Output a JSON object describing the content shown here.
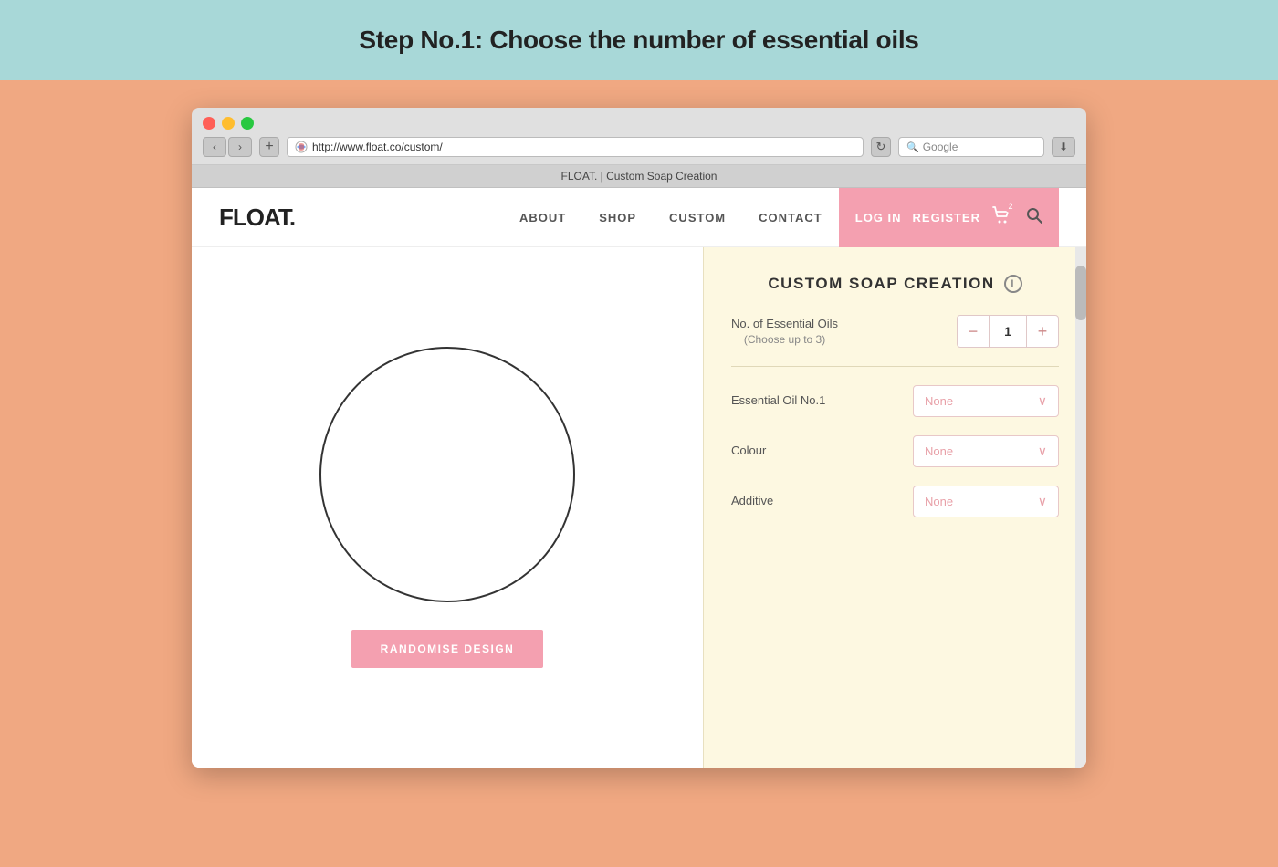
{
  "instruction": {
    "text": "Step No.1: Choose the number of essential oils"
  },
  "browser": {
    "title": "FLOAT. | Custom Soap Creation",
    "url": "http://www.float.co/custom/",
    "url_display": "http://www.float.co/custom/",
    "search_placeholder": "Google",
    "nav_back": "‹",
    "nav_forward": "›",
    "add_tab": "+",
    "refresh": "↻"
  },
  "site": {
    "logo": "FLOAT.",
    "nav": {
      "about": "ABOUT",
      "shop": "SHOP",
      "custom": "CUSTOM",
      "contact": "CONTACT",
      "login": "LOG IN",
      "register": "REGISTER",
      "cart_count": "2"
    }
  },
  "soap_preview": {
    "randomise_btn": "RANDOMISE DESIGN"
  },
  "controls": {
    "title": "CUSTOM SOAP CREATION",
    "info_icon": "i",
    "essential_oils_label": "No. of Essential Oils",
    "essential_oils_sublabel": "(Choose up to 3)",
    "essential_oils_value": "1",
    "minus_btn": "−",
    "plus_btn": "+",
    "oil1_label": "Essential Oil No.1",
    "oil1_value": "None",
    "colour_label": "Colour",
    "colour_value": "None",
    "additive_label": "Additive",
    "additive_value": "None"
  },
  "colors": {
    "teal_header": "#a8d8d8",
    "peach_bg": "#f0a882",
    "pink_cta": "#f4a0b0",
    "cream_panel": "#fdf8e1",
    "soap_circle_border": "#333"
  }
}
